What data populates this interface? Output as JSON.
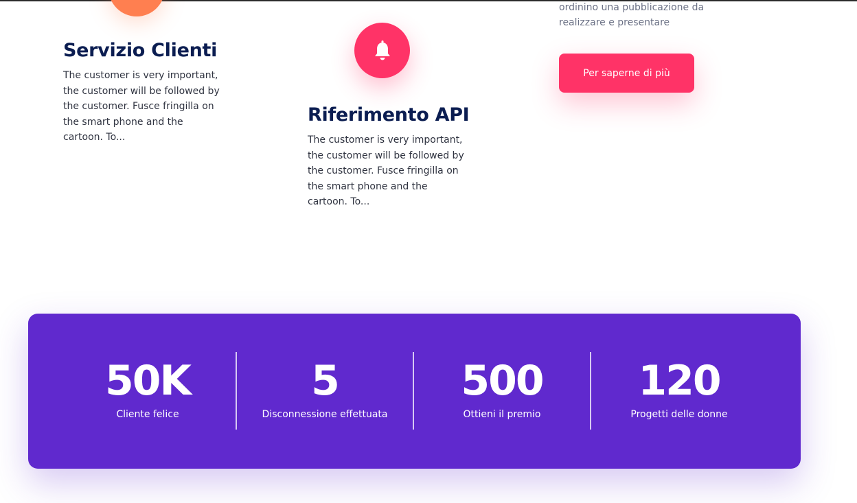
{
  "features": [
    {
      "title": "Servizio Clienti",
      "text": "The customer is very important, the customer will be followed by the customer. Fusce fringilla on the smart phone and the cartoon. To...",
      "icon": "orange-circle-icon"
    },
    {
      "title": "Riferimento API",
      "text": "The customer is very important, the customer will be followed by the customer. Fusce fringilla on the smart phone and the cartoon. To...",
      "icon": "bell-icon"
    }
  ],
  "cta": {
    "description": "ordinino una pubblicazione da realizzare e presentare",
    "button_label": "Per saperne di più"
  },
  "stats": [
    {
      "value": "50K",
      "label": "Cliente felice"
    },
    {
      "value": "5",
      "label": "Disconnessione effettuata"
    },
    {
      "value": "500",
      "label": "Ottieni il premio"
    },
    {
      "value": "120",
      "label": "Progetti delle donne"
    }
  ],
  "colors": {
    "accent_red": "#ff3367",
    "accent_orange": "#ff7f50",
    "stats_panel": "#6029ce",
    "heading": "#0b1d51"
  }
}
